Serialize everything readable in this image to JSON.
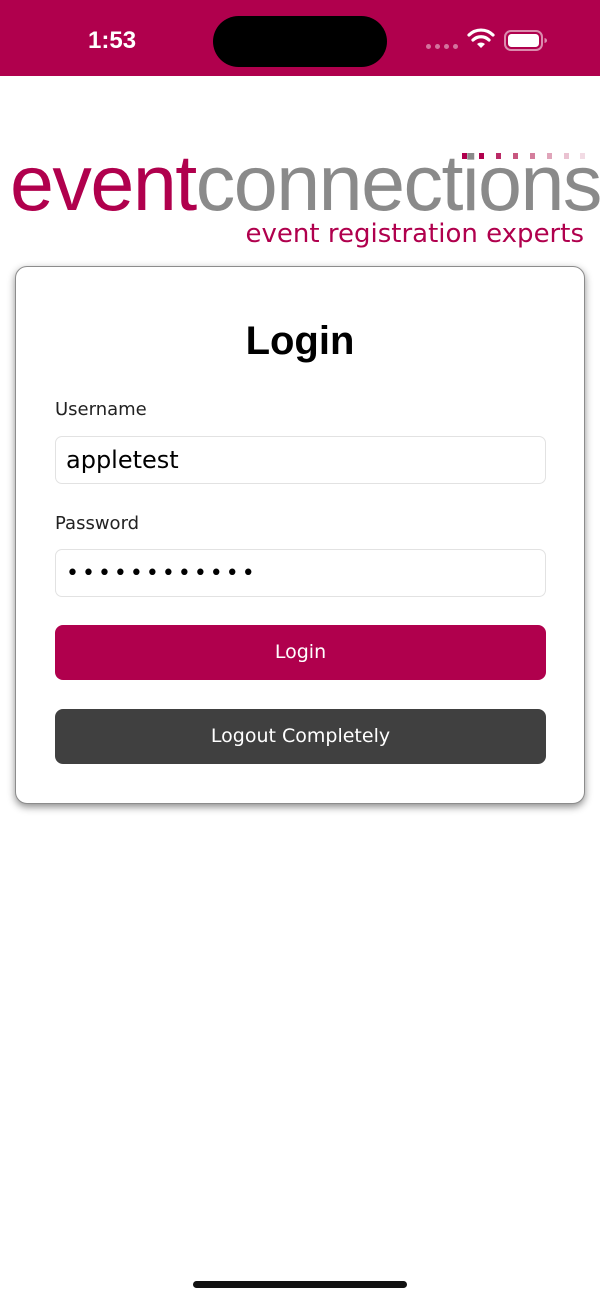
{
  "status_bar": {
    "time": "1:53",
    "background_color": "#b0004d",
    "icons": [
      "cellular-signal-icon",
      "wifi-icon",
      "battery-icon"
    ]
  },
  "logo": {
    "part_event": "event",
    "part_connections": "connections",
    "tagline": "event registration experts",
    "brand_color": "#b0004d",
    "secondary_color": "#8a8a8a"
  },
  "login": {
    "title": "Login",
    "username_label": "Username",
    "username_value": "appletest",
    "password_label": "Password",
    "password_value": "••••••••••••",
    "login_button": "Login",
    "logout_button": "Logout Completely",
    "login_button_color": "#b0004d",
    "logout_button_color": "#404040"
  }
}
